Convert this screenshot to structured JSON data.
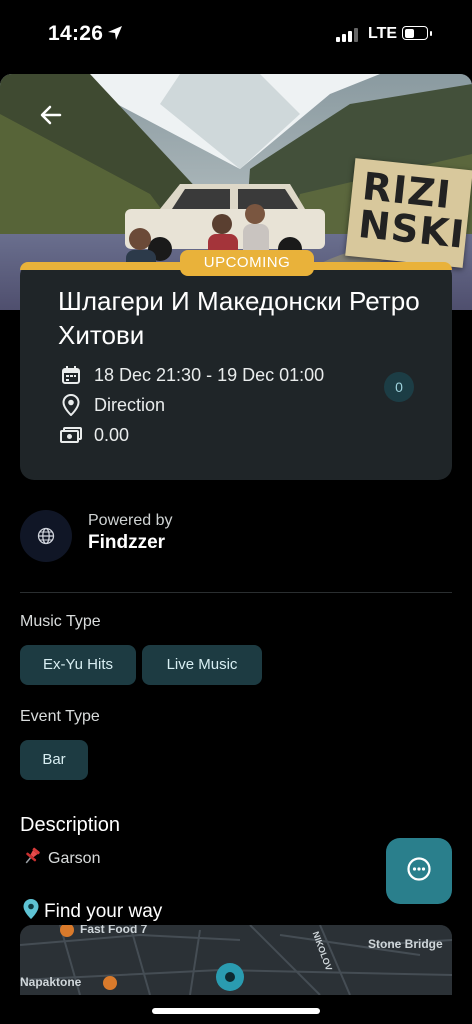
{
  "status_bar": {
    "time": "14:26",
    "network": "LTE"
  },
  "event": {
    "badge": "UPCOMING",
    "title": "Шлагери И Македонски Ретро Хитови",
    "datetime": "18 Dec 21:30 - 19 Dec 01:00",
    "location": "Direction",
    "price": "0.00",
    "attendees": "0",
    "poster_text": "RIZI NSKI"
  },
  "organizer": {
    "powered_label": "Powered by",
    "name": "Findzzer"
  },
  "music_type": {
    "label": "Music Type",
    "chips": [
      "Ex-Yu Hits",
      "Live Music"
    ]
  },
  "event_type": {
    "label": "Event Type",
    "chips": [
      "Bar"
    ]
  },
  "description": {
    "title": "Description",
    "text": "Garson"
  },
  "find_way": {
    "label": "Find your way",
    "map_labels": [
      "Fast Food 7",
      "Stone Bridge",
      "NIKOLOV",
      "Napaktone"
    ]
  },
  "colors": {
    "accent": "#e9b23a",
    "chip_bg": "#1d3b42",
    "fab": "#2a7f8c",
    "card_bg": "#1f2528"
  }
}
